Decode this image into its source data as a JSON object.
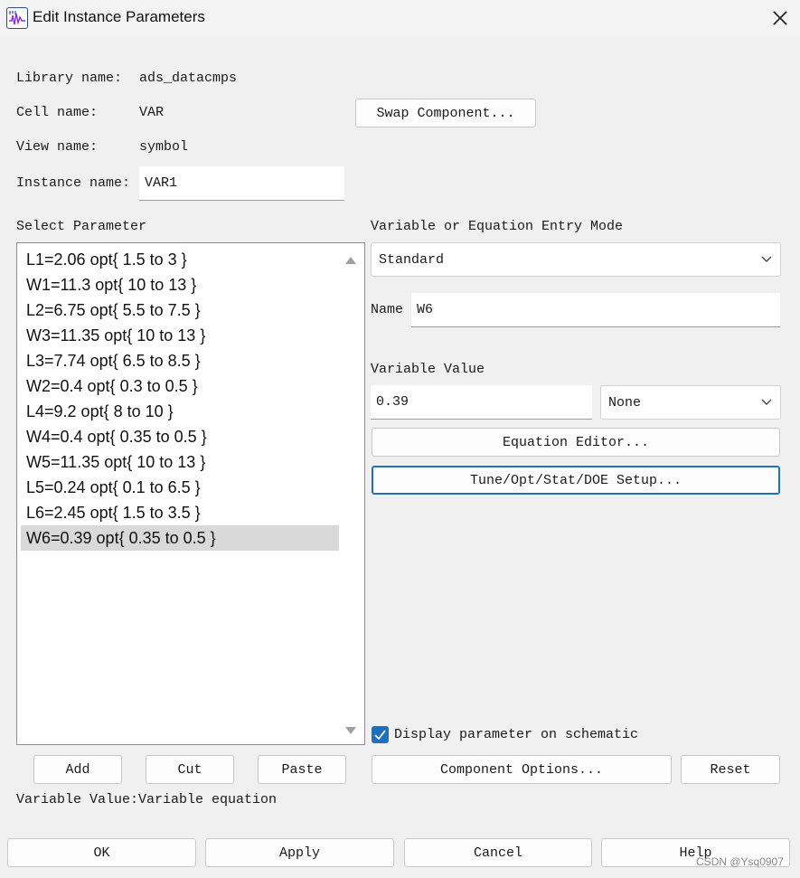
{
  "window": {
    "title": "Edit Instance Parameters"
  },
  "info": {
    "library_label": "Library name:",
    "library_value": "ads_datacmps",
    "cell_label": "Cell name:",
    "cell_value": "VAR",
    "view_label": "View name:",
    "view_value": "symbol",
    "instance_label": "Instance name:",
    "instance_value": "VAR1",
    "swap_button": "Swap Component..."
  },
  "parameters": {
    "label": "Select Parameter",
    "items": [
      "L1=2.06 opt{ 1.5 to 3 }",
      "W1=11.3 opt{ 10 to 13 }",
      "L2=6.75 opt{ 5.5 to 7.5 }",
      "W3=11.35 opt{ 10 to 13 }",
      "L3=7.74 opt{ 6.5 to 8.5 }",
      "W2=0.4 opt{ 0.3 to 0.5 }",
      "L4=9.2 opt{ 8 to 10 }",
      "W4=0.4 opt{ 0.35 to 0.5 }",
      "W5=11.35 opt{ 10 to 13 }",
      "L5=0.24 opt{ 0.1 to 6.5 }",
      "L6=2.45 opt{ 1.5 to 3.5 }",
      "W6=0.39 opt{ 0.35 to 0.5 }"
    ],
    "selected_index": 11
  },
  "entry": {
    "mode_label": "Variable or Equation Entry Mode",
    "mode_value": "Standard",
    "name_label": "Name",
    "name_value": "W6",
    "value_label": "Variable Value",
    "value_value": "0.39",
    "unit_value": "None",
    "equation_editor_button": "Equation Editor...",
    "tune_button": "Tune/Opt/Stat/DOE Setup...",
    "display_checkbox_label": "Display parameter on schematic",
    "display_checked": true
  },
  "list_buttons": {
    "add": "Add",
    "cut": "Cut",
    "paste": "Paste"
  },
  "component_options_button": "Component Options...",
  "reset_button": "Reset",
  "status_text": "Variable Value:Variable equation",
  "footer": {
    "ok": "OK",
    "apply": "Apply",
    "cancel": "Cancel",
    "help": "Help"
  },
  "watermark": "CSDN @Ysq0907",
  "colors": {
    "accent": "#1f6fbf",
    "selection": "#d9d9d9",
    "background": "#f0f0f0"
  }
}
